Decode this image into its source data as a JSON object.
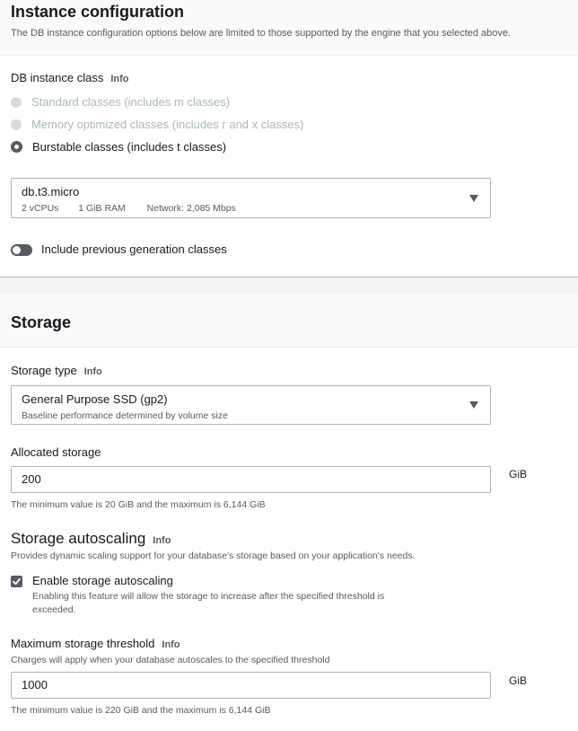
{
  "instance_config": {
    "title": "Instance configuration",
    "description": "The DB instance configuration options below are limited to those supported by the engine that you selected above.",
    "db_class_label": "DB instance class",
    "info": "Info",
    "options": [
      {
        "label": "Standard classes (includes m classes)",
        "state": "disabled"
      },
      {
        "label": "Memory optimized classes (includes r and x classes)",
        "state": "disabled"
      },
      {
        "label": "Burstable classes (includes t classes)",
        "state": "selected"
      }
    ],
    "instance_select": {
      "value": "db.t3.micro",
      "vcpus": "2 vCPUs",
      "ram": "1 GiB RAM",
      "network": "Network: 2,085 Mbps"
    },
    "previous_gen_label": "Include previous generation classes"
  },
  "storage": {
    "title": "Storage",
    "type_label": "Storage type",
    "info": "Info",
    "type_select": {
      "value": "General Purpose SSD (gp2)",
      "description": "Baseline performance determined by volume size"
    },
    "allocated_label": "Allocated storage",
    "allocated_value": "200",
    "unit": "GiB",
    "allocated_hint": "The minimum value is 20 GiB and the maximum is 6,144 GiB",
    "autoscaling": {
      "title": "Storage autoscaling",
      "info": "Info",
      "description": "Provides dynamic scaling support for your database's storage based on your application's needs.",
      "enable_label": "Enable storage autoscaling",
      "enable_desc_line1": "Enabling this feature will allow the storage to increase after the specified threshold is",
      "enable_desc_line2": "exceeded.",
      "max_label": "Maximum storage threshold",
      "max_info": "Info",
      "max_desc": "Charges will apply when your database autoscales to the specified threshold",
      "max_value": "1000",
      "max_unit": "GiB",
      "max_hint": "The minimum value is 220 GiB and the maximum is 6,144 GiB"
    }
  },
  "colors": {
    "text": "#16191f",
    "secondary_text": "#545b64",
    "border": "#aab7b8",
    "control": "#545b64"
  }
}
